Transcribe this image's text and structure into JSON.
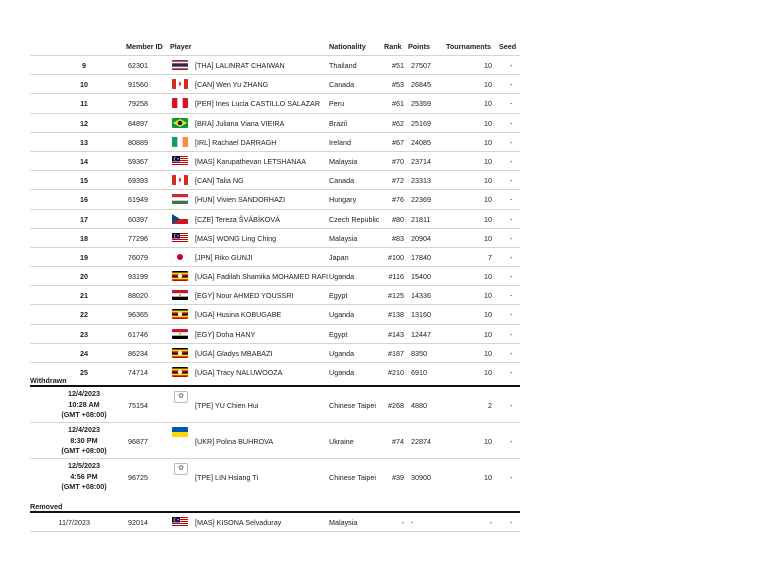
{
  "header": {
    "member_id": "Member ID",
    "player": "Player",
    "nationality": "Nationality",
    "rank": "Rank",
    "points": "Points",
    "tournaments": "Tournaments",
    "seed": "Seed"
  },
  "players": [
    {
      "n": "9",
      "id": "62301",
      "flag": "thailand-flag",
      "player": "[THA] LALINRAT CHAIWAN",
      "nat": "Thailand",
      "rank": "#51",
      "pts": "27507",
      "tour": "10",
      "seed": "-"
    },
    {
      "n": "10",
      "id": "91560",
      "flag": "canada-flag",
      "player": "[CAN] Wen Yu ZHANG",
      "nat": "Canada",
      "rank": "#53",
      "pts": "26845",
      "tour": "10",
      "seed": "-"
    },
    {
      "n": "11",
      "id": "79258",
      "flag": "peru-flag",
      "player": "[PER] Ines Lucia CASTILLO SALAZAR",
      "nat": "Peru",
      "rank": "#61",
      "pts": "25359",
      "tour": "10",
      "seed": "-"
    },
    {
      "n": "12",
      "id": "84897",
      "flag": "brazil-flag",
      "player": "[BRA] Juliana Viana VIEIRA",
      "nat": "Brazil",
      "rank": "#62",
      "pts": "25169",
      "tour": "10",
      "seed": "-"
    },
    {
      "n": "13",
      "id": "80889",
      "flag": "ireland-flag",
      "player": "[IRL] Rachael DARRAGH",
      "nat": "Ireland",
      "rank": "#67",
      "pts": "24085",
      "tour": "10",
      "seed": "-"
    },
    {
      "n": "14",
      "id": "59367",
      "flag": "malaysia-flag",
      "player": "[MAS] Karupathevan LETSHANAA",
      "nat": "Malaysia",
      "rank": "#70",
      "pts": "23714",
      "tour": "10",
      "seed": "-"
    },
    {
      "n": "15",
      "id": "69393",
      "flag": "canada-flag",
      "player": "[CAN] Talia NG",
      "nat": "Canada",
      "rank": "#72",
      "pts": "23313",
      "tour": "10",
      "seed": "-"
    },
    {
      "n": "16",
      "id": "61949",
      "flag": "hungary-flag",
      "player": "[HUN] Vivien SANDORHAZI",
      "nat": "Hungary",
      "rank": "#76",
      "pts": "22369",
      "tour": "10",
      "seed": "-"
    },
    {
      "n": "17",
      "id": "60397",
      "flag": "czech-flag",
      "player": "[CZE] Tereza ŠVÁBÍKOVÁ",
      "nat": "Czech Republic",
      "rank": "#80",
      "pts": "21811",
      "tour": "10",
      "seed": "-"
    },
    {
      "n": "18",
      "id": "77296",
      "flag": "malaysia-flag",
      "player": "[MAS] WONG Ling Ching",
      "nat": "Malaysia",
      "rank": "#83",
      "pts": "20904",
      "tour": "10",
      "seed": "-"
    },
    {
      "n": "19",
      "id": "76079",
      "flag": "japan-flag",
      "player": "[JPN] Riko GUNJI",
      "nat": "Japan",
      "rank": "#100",
      "pts": "17840",
      "tour": "7",
      "seed": "-"
    },
    {
      "n": "20",
      "id": "93199",
      "flag": "uganda-flag",
      "player": "[UGA] Fadilah Shamika MOHAMED RAFI",
      "nat": "Uganda",
      "rank": "#116",
      "pts": "15400",
      "tour": "10",
      "seed": "-"
    },
    {
      "n": "21",
      "id": "88020",
      "flag": "egypt-flag",
      "player": "[EGY] Nour AHMED YOUSSRI",
      "nat": "Egypt",
      "rank": "#125",
      "pts": "14336",
      "tour": "10",
      "seed": "-"
    },
    {
      "n": "22",
      "id": "96365",
      "flag": "uganda-flag",
      "player": "[UGA] Husina KOBUGABE",
      "nat": "Uganda",
      "rank": "#138",
      "pts": "13160",
      "tour": "10",
      "seed": "-"
    },
    {
      "n": "23",
      "id": "61746",
      "flag": "egypt-flag",
      "player": "[EGY] Doha HANY",
      "nat": "Egypt",
      "rank": "#143",
      "pts": "12447",
      "tour": "10",
      "seed": "-"
    },
    {
      "n": "24",
      "id": "86234",
      "flag": "uganda-flag",
      "player": "[UGA] Gladys MBABAZI",
      "nat": "Uganda",
      "rank": "#187",
      "pts": "8350",
      "tour": "10",
      "seed": "-"
    },
    {
      "n": "25",
      "id": "74714",
      "flag": "uganda-flag",
      "player": "[UGA] Tracy NALUWOOZA",
      "nat": "Uganda",
      "rank": "#210",
      "pts": "6910",
      "tour": "10",
      "seed": "-"
    }
  ],
  "withdrawn": {
    "title": "Withdrawn",
    "rows": [
      {
        "date": "12/4/2023",
        "time": "10:28 AM",
        "tz": "(GMT +08:00)",
        "id": "75154",
        "flag": "tpe-icon",
        "player": "[TPE] YU Chien Hui",
        "nat": "Chinese Taipei",
        "rank": "#268",
        "pts": "4880",
        "tour": "2",
        "seed": "-"
      },
      {
        "date": "12/4/2023",
        "time": "8:30 PM",
        "tz": "(GMT +08:00)",
        "id": "96877",
        "flag": "ukraine-flag",
        "player": "[UKR] Polina BUHROVA",
        "nat": "Ukraine",
        "rank": "#74",
        "pts": "22874",
        "tour": "10",
        "seed": "-"
      },
      {
        "date": "12/5/2023",
        "time": "4:56 PM",
        "tz": "(GMT +08:00)",
        "id": "96725",
        "flag": "tpe-icon",
        "player": "[TPE] LIN Hsiang Ti",
        "nat": "Chinese Taipei",
        "rank": "#39",
        "pts": "30900",
        "tour": "10",
        "seed": "-"
      }
    ]
  },
  "removed": {
    "title": "Removed",
    "rows": [
      {
        "date": "11/7/2023",
        "id": "92014",
        "flag": "malaysia-flag",
        "player": "[MAS] KISONA Selvaduray",
        "nat": "Malaysia",
        "rank": "-",
        "pts": "-",
        "tour": "-",
        "seed": "-"
      }
    ]
  }
}
